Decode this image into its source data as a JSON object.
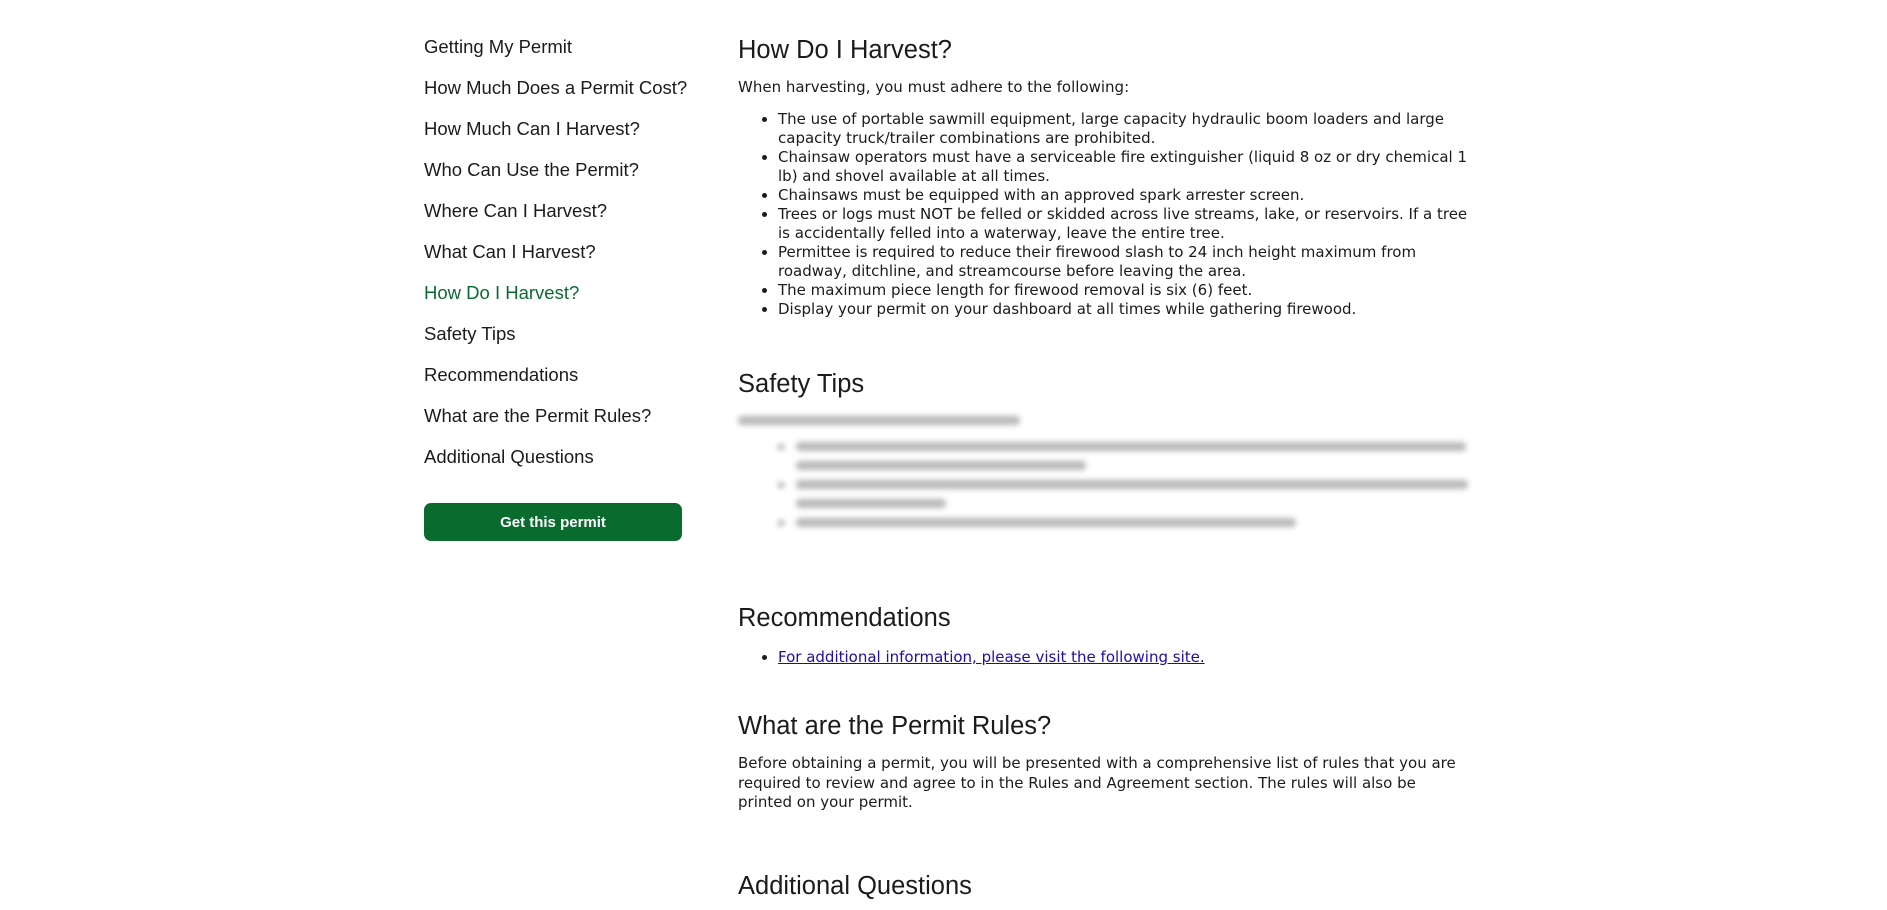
{
  "sidebar": {
    "items": [
      {
        "label": "Getting My Permit"
      },
      {
        "label": "How Much Does a Permit Cost?"
      },
      {
        "label": "How Much Can I Harvest?"
      },
      {
        "label": "Who Can Use the Permit?"
      },
      {
        "label": "Where Can I Harvest?"
      },
      {
        "label": "What Can I Harvest?"
      },
      {
        "label": "How Do I Harvest?",
        "active": true
      },
      {
        "label": "Safety Tips"
      },
      {
        "label": "Recommendations"
      },
      {
        "label": "What are the Permit Rules?"
      },
      {
        "label": "Additional Questions"
      }
    ],
    "cta_label": "Get this permit"
  },
  "colors": {
    "accent": "#0a6b2f",
    "link": "#1a0dab",
    "text": "#1b1b1b"
  },
  "harvest": {
    "title": "How Do I Harvest?",
    "intro": "When harvesting, you must adhere to the following:",
    "rules": [
      "The use of portable sawmill equipment, large capacity hydraulic boom loaders and large capacity truck/trailer combinations are prohibited.",
      "Chainsaw operators must have a serviceable fire extinguisher (liquid 8 oz or dry chemical 1 lb) and shovel available at all times.",
      "Chainsaws must be equipped with an approved spark arrester screen.",
      "Trees or logs must NOT be felled or skidded across live streams, lake, or reservoirs. If a tree is accidentally felled into a waterway, leave the entire tree.",
      "Permittee is required to reduce their firewood slash to 24 inch height maximum from roadway, ditchline, and streamcourse before leaving the area.",
      "The maximum piece length for firewood removal is six (6) feet.",
      "Display your permit on your dashboard at all times while gathering firewood."
    ]
  },
  "safety": {
    "title": "Safety Tips"
  },
  "recommendations": {
    "title": "Recommendations",
    "link": "For additional information, please visit the following site."
  },
  "permit_rules": {
    "title": "What are the Permit Rules?",
    "body": "Before obtaining a permit, you will be presented with a comprehensive list of rules that you are required to review and agree to in the Rules and Agreement section. The rules will also be printed on your permit."
  },
  "additional": {
    "title": "Additional Questions"
  }
}
